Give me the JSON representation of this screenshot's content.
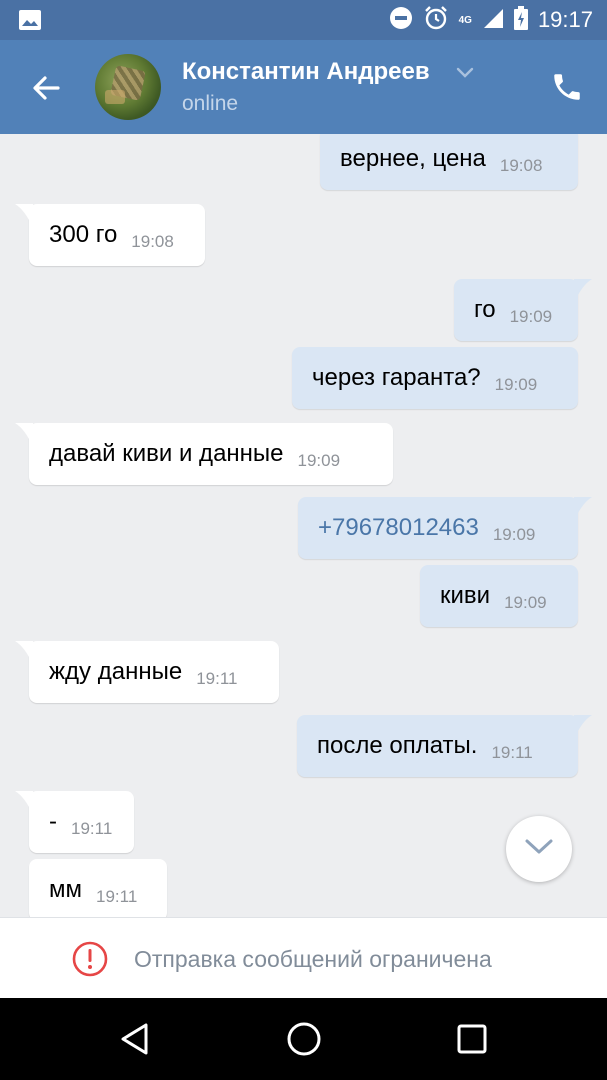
{
  "status_bar": {
    "time": "19:17",
    "network": "4G",
    "icons": [
      "gallery-icon",
      "dnd-icon",
      "alarm-icon",
      "signal-icon",
      "battery-icon"
    ]
  },
  "header": {
    "contact_name": "Константин Андреев",
    "contact_status": "online",
    "icons": [
      "back-arrow-icon",
      "chevron-down-icon",
      "phone-icon"
    ]
  },
  "messages": [
    {
      "dir": "out",
      "text": "вернее, цена",
      "time": "19:08"
    },
    {
      "dir": "in",
      "text": "300 го",
      "time": "19:08"
    },
    {
      "dir": "out",
      "text": "го",
      "time": "19:09"
    },
    {
      "dir": "out",
      "text": "через гаранта?",
      "time": "19:09"
    },
    {
      "dir": "in",
      "text": "давай киви и данные",
      "time": "19:09"
    },
    {
      "dir": "out",
      "text": "+79678012463",
      "time": "19:09",
      "link": true
    },
    {
      "dir": "out",
      "text": "киви",
      "time": "19:09"
    },
    {
      "dir": "in",
      "text": "жду данные",
      "time": "19:11"
    },
    {
      "dir": "out",
      "text": "после оплаты.",
      "time": "19:11"
    },
    {
      "dir": "in",
      "text": "-",
      "time": "19:11"
    },
    {
      "dir": "in",
      "text": "мм",
      "time": "19:11"
    }
  ],
  "restriction": {
    "text": "Отправка сообщений ограничена",
    "icon": "warning-circle-icon"
  },
  "navigation": [
    "back-triangle-icon",
    "home-circle-icon",
    "recents-square-icon"
  ],
  "colors": {
    "header": "#5181b8",
    "status_bar": "#4a71a4",
    "background": "#edeef0",
    "outgoing_bubble": "#dae6f4",
    "incoming_bubble": "#ffffff",
    "link": "#4a76a8",
    "warning": "#e64646"
  }
}
